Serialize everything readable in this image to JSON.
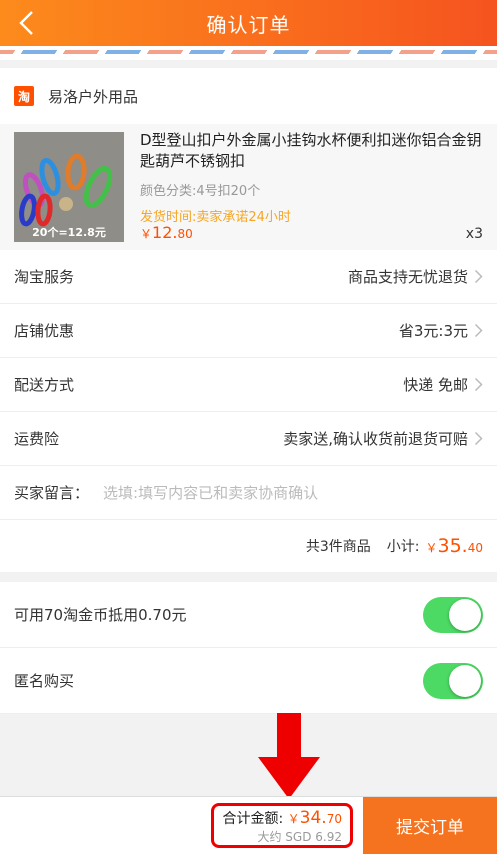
{
  "header": {
    "title": "确认订单"
  },
  "shop": {
    "logo_text": "淘",
    "name": "易洛户外用品"
  },
  "product": {
    "title": "D型登山扣户外金属小挂钩水杯便利扣迷你铝合金钥匙葫芦不锈钢扣",
    "variant": "颜色分类:4号扣20个",
    "ship_time": "发货时间:卖家承诺24小时",
    "price_symbol": "￥",
    "price_int": "12.",
    "price_dec": "80",
    "qty": "x3",
    "thumb_caption": "20个=12.8元"
  },
  "rows": {
    "service_label": "淘宝服务",
    "service_value": "商品支持无忧退货",
    "discount_label": "店铺优惠",
    "discount_value": "省3元:3元",
    "delivery_label": "配送方式",
    "delivery_value": "快递 免邮",
    "insurance_label": "运费险",
    "insurance_value": "卖家送,确认收货前退货可赔",
    "message_label": "买家留言：",
    "message_placeholder": "选填:填写内容已和卖家协商确认"
  },
  "subtotal": {
    "count_text": "共3件商品",
    "label": "小计:",
    "symbol": "￥",
    "int": "35.",
    "dec": "40"
  },
  "toggles": {
    "coins_label": "可用70淘金币抵用0.70元",
    "coins_on": true,
    "anon_label": "匿名购买",
    "anon_on": true
  },
  "footer": {
    "total_label": "合计金额:",
    "symbol": "￥",
    "total_int": "34.",
    "total_dec": "70",
    "approx": "大约 SGD 6.92",
    "submit_label": "提交订单"
  },
  "colors": {
    "accent": "#ff5000",
    "header_start": "#fc8b1c",
    "header_end": "#f5531f",
    "switch_on": "#4cd964",
    "annotation": "#ee0000"
  }
}
